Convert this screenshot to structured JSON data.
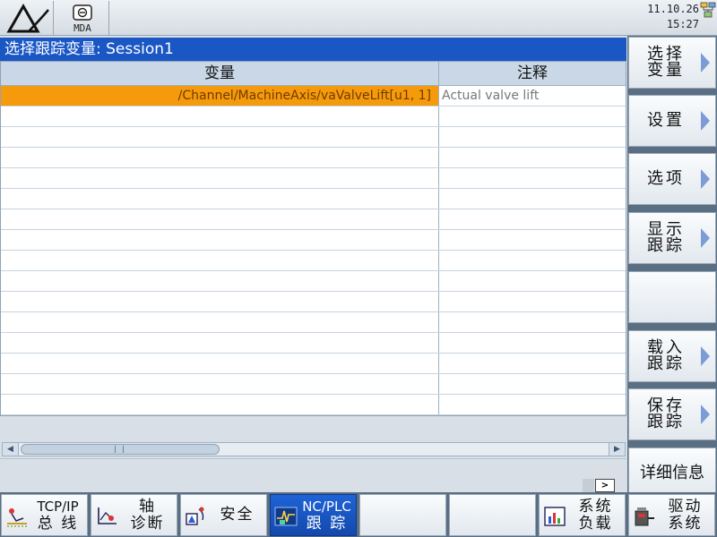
{
  "topbar": {
    "mode": "MDA",
    "date": "11.10.26",
    "time": "15:27"
  },
  "title": "选择跟踪变量: Session1",
  "table": {
    "headers": [
      "变量",
      "注释"
    ],
    "rows": [
      {
        "variable": "/Channel/MachineAxis/vaValveLift[u1, 1]",
        "comment": "Actual valve lift",
        "selected": true
      }
    ],
    "empty_rows": 15
  },
  "pager": ">",
  "vertical_softkeys": [
    {
      "lines": [
        "选择",
        "变量"
      ],
      "arrow": true
    },
    {
      "lines": [
        "设置"
      ],
      "arrow": true
    },
    {
      "lines": [
        "选项"
      ],
      "arrow": true
    },
    {
      "lines": [
        "显示",
        "跟踪"
      ],
      "arrow": true
    },
    {
      "lines": [],
      "arrow": false
    },
    {
      "lines": [
        "载入",
        "跟踪"
      ],
      "arrow": true
    },
    {
      "lines": [
        "保存",
        "跟踪"
      ],
      "arrow": true
    },
    {
      "lines": [
        "详细信息"
      ],
      "arrow": false
    }
  ],
  "horizontal_softkeys": [
    {
      "lines": [
        "TCP/IP",
        "总 线"
      ],
      "icon": "network-bus-icon",
      "active": false
    },
    {
      "lines": [
        "轴",
        "诊断"
      ],
      "icon": "axis-diagnosis-icon",
      "active": false
    },
    {
      "lines": [
        "安全"
      ],
      "icon": "safety-icon",
      "active": false
    },
    {
      "lines": [
        "NC/PLC",
        "跟 踪"
      ],
      "icon": "trace-icon",
      "active": true
    },
    {
      "lines": [],
      "icon": "",
      "active": false
    },
    {
      "lines": [],
      "icon": "",
      "active": false
    },
    {
      "lines": [
        "系统",
        "负载"
      ],
      "icon": "system-load-icon",
      "active": false
    },
    {
      "lines": [
        "驱动",
        "系统"
      ],
      "icon": "drive-system-icon",
      "active": false
    }
  ],
  "colors": {
    "title_bar": "#1a57c4",
    "selection": "#f59b0b",
    "softkey_arrow": "#7d9bd6"
  }
}
